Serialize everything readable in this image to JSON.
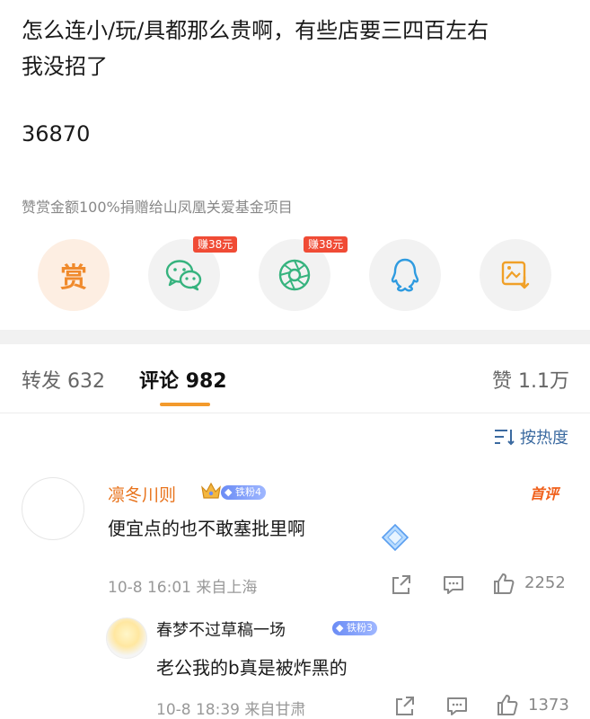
{
  "post": {
    "line1": "怎么连小/玩/具都那么贵啊，有些店要三四百左右",
    "line2": "我没招了",
    "number": "36870",
    "donate_note": "赞赏金额100%捐赠给山凤凰关爱基金项目"
  },
  "share": {
    "reward_label": "赏",
    "wechat_badge": "赚38元",
    "moments_badge": "赚38元",
    "icons": [
      "reward-icon",
      "wechat-icon",
      "moments-icon",
      "qq-icon",
      "save-image-icon"
    ]
  },
  "tabs": {
    "repost_label": "转发",
    "repost_count": "632",
    "comment_label": "评论",
    "comment_count": "982",
    "like_label": "赞",
    "like_count": "1.1万"
  },
  "sort": {
    "label": "按热度"
  },
  "comments": [
    {
      "user": "凛冬川则",
      "fan_level": "铁粉4",
      "first_label": "首评",
      "text": "便宜点的也不敢塞批里啊",
      "time": "10-8 16:01",
      "location": "来自上海",
      "likes": "2252"
    },
    {
      "user": "春梦不过草稿一场",
      "fan_level": "铁粉3",
      "text": "老公我的b真是被炸黑的",
      "time": "10-8 18:39",
      "location": "来自甘肃",
      "likes": "1373"
    }
  ],
  "colors": {
    "accent": "#f39a2c",
    "username": "#e8731c",
    "link": "#3b6aa0",
    "badge": "#f04b35"
  }
}
